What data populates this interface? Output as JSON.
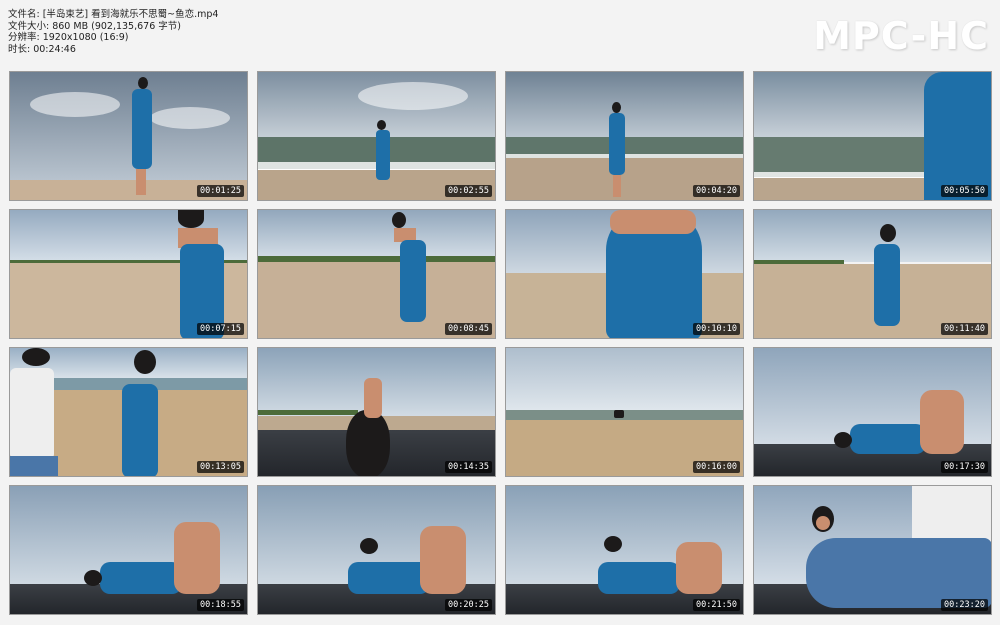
{
  "header": {
    "filename": "文件名: [半岛束艺] 看到海就乐不思蜀~鱼恋.mp4",
    "filesize": "文件大小: 860 MB (902,135,676 字节)",
    "resolution": "分辨率: 1920x1080 (16:9)",
    "duration": "时长: 00:24:46"
  },
  "logo": "MPC-HC",
  "thumbnails": [
    {
      "time": "00:01:25",
      "scene": "beach-wide"
    },
    {
      "time": "00:02:55",
      "scene": "surf"
    },
    {
      "time": "00:04:20",
      "scene": "surf"
    },
    {
      "time": "00:05:50",
      "scene": "closeup-surf"
    },
    {
      "time": "00:07:15",
      "scene": "sand"
    },
    {
      "time": "00:08:45",
      "scene": "sand"
    },
    {
      "time": "00:10:10",
      "scene": "closeup-sand"
    },
    {
      "time": "00:11:40",
      "scene": "sand"
    },
    {
      "time": "00:13:05",
      "scene": "two-people"
    },
    {
      "time": "00:14:35",
      "scene": "car-roof"
    },
    {
      "time": "00:16:00",
      "scene": "car-distance"
    },
    {
      "time": "00:17:30",
      "scene": "car-roof-lying"
    },
    {
      "time": "00:18:55",
      "scene": "car-roof-lying"
    },
    {
      "time": "00:20:25",
      "scene": "car-roof-lying"
    },
    {
      "time": "00:21:50",
      "scene": "car-roof-lying"
    },
    {
      "time": "00:23:20",
      "scene": "two-people-car"
    }
  ]
}
